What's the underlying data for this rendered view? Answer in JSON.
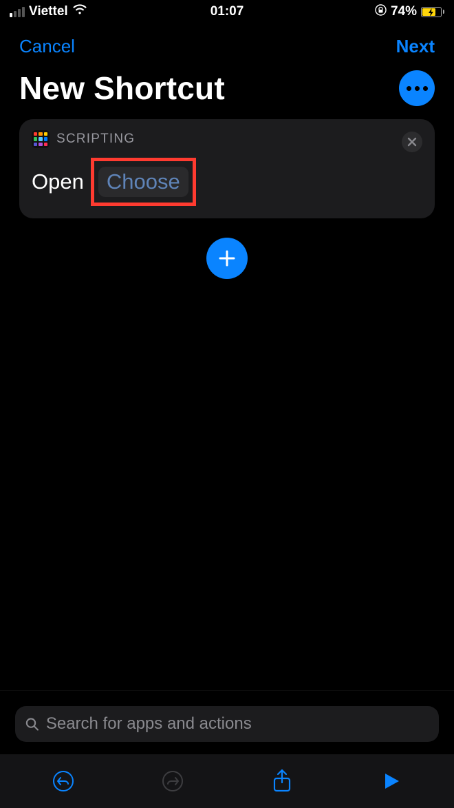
{
  "status": {
    "carrier": "Viettel",
    "time": "01:07",
    "battery_pct": "74%",
    "battery_fill_pct": 74
  },
  "nav": {
    "cancel": "Cancel",
    "next": "Next"
  },
  "title": "New Shortcut",
  "action_card": {
    "category": "SCRIPTING",
    "verb": "Open",
    "param_placeholder": "Choose"
  },
  "search": {
    "placeholder": "Search for apps and actions"
  },
  "colors": {
    "accent": "#0a84ff",
    "highlight_box": "#ff3b30"
  },
  "toolbar": {
    "undo_enabled": true,
    "redo_enabled": false
  }
}
